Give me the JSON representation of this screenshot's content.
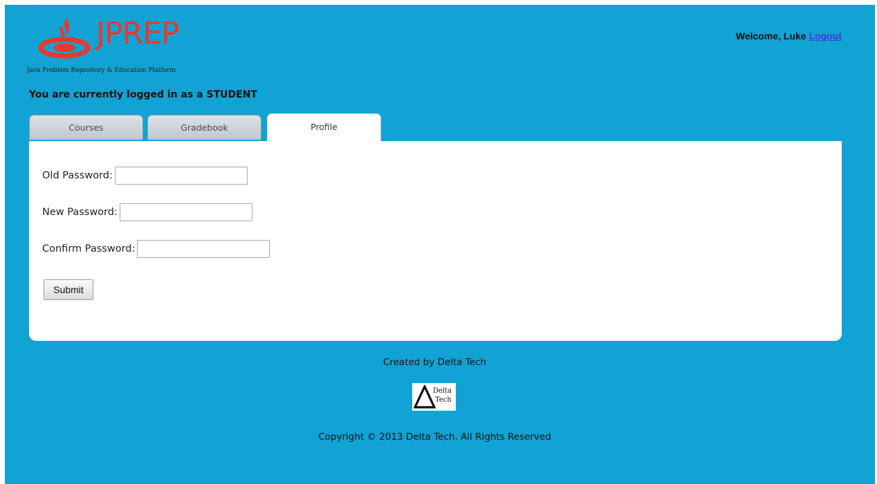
{
  "header": {
    "logo_text": "JPREP",
    "logo_subtitle": "Java Problem Repository & Education Platform",
    "welcome_text": "Welcome, Luke",
    "logout_link": "Logout",
    "logged_in_message": "You are currently logged in as a STUDENT"
  },
  "tabs": [
    {
      "label": "Courses",
      "active": false
    },
    {
      "label": "Gradebook",
      "active": false
    },
    {
      "label": "Profile",
      "active": true
    }
  ],
  "profile_form": {
    "old_password_label": "Old Password:",
    "old_password_value": "",
    "new_password_label": "New Password:",
    "new_password_value": "",
    "confirm_password_label": "Confirm Password:",
    "confirm_password_value": "",
    "submit_label": "Submit"
  },
  "footer": {
    "created_by": "Created by Delta Tech",
    "logo_word1": "Delta",
    "logo_word2": "Tech",
    "copyright": "Copyright © 2013 Delta Tech. All Rights Reserved"
  },
  "colors": {
    "page_background": "#11a3d4",
    "logo_red": "#e8382c",
    "link_blue": "#3e3bd6",
    "panel_background": "#ffffff"
  },
  "icons": {
    "logo_icon": "flame-icon",
    "footer_logo_icon": "delta-triangle-icon"
  }
}
